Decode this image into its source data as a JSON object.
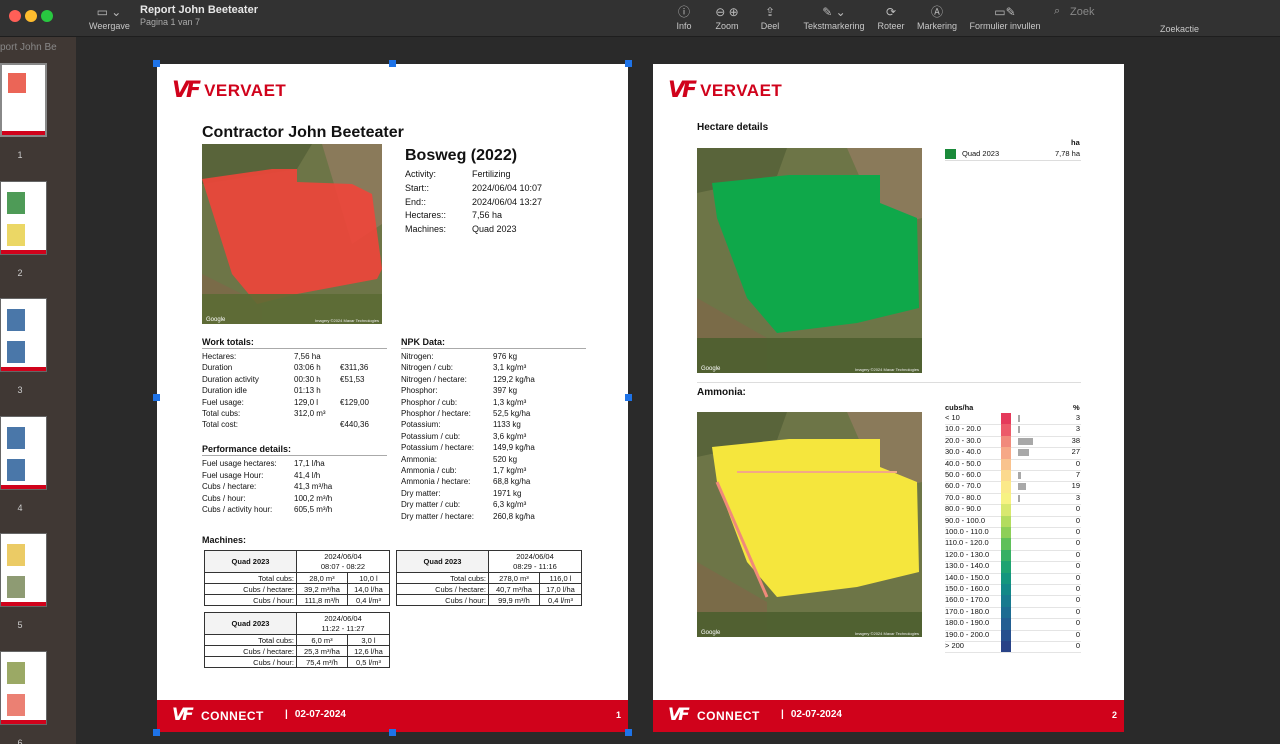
{
  "window": {
    "title": "Report John Beeteater",
    "subtitle": "Pagina 1 van 7",
    "view_label": "Weergave"
  },
  "toolbar": {
    "info": "Info",
    "zoom": "Zoom",
    "share": "Deel",
    "markup_text": "Tekstmarkering",
    "rotate": "Roteer",
    "markup": "Markering",
    "form": "Formulier invullen",
    "search_placeholder": "Zoek",
    "search_action": "Zoekactie"
  },
  "sidebar": {
    "doc_title": "port John Be",
    "thumbs": [
      "1",
      "2",
      "3",
      "4",
      "5",
      "6"
    ]
  },
  "brand": {
    "name": "VERVAET",
    "mark": "VF",
    "connect": "CONNECT",
    "date": "02-07-2024"
  },
  "page1": {
    "number": "1",
    "contractor": "Contractor John Beeteater",
    "field": "Bosweg (2022)",
    "info": [
      [
        "Activity:",
        "Fertilizing"
      ],
      [
        "Start::",
        "2024/06/04 10:07"
      ],
      [
        "End::",
        "2024/06/04 13:27"
      ],
      [
        "Hectares::",
        "7,56 ha"
      ],
      [
        "Machines:",
        "Quad 2023"
      ]
    ],
    "work_title": "Work totals:",
    "work": [
      [
        "Hectares:",
        "7,56 ha",
        ""
      ],
      [
        "Duration",
        "03:06 h",
        "€311,36"
      ],
      [
        "Duration activity",
        "00:30 h",
        "€51,53"
      ],
      [
        "Duration idle",
        "01:13 h",
        ""
      ],
      [
        "Fuel usage:",
        "129,0 l",
        "€129,00"
      ],
      [
        "Total cubs:",
        "312,0 m³",
        ""
      ],
      [
        "Total cost:",
        "",
        "€440,36"
      ]
    ],
    "perf_title": "Performance details:",
    "perf": [
      [
        "Fuel usage hectares:",
        "17,1 l/ha"
      ],
      [
        "Fuel usage Hour:",
        "41,4 l/h"
      ],
      [
        "Cubs / hectare:",
        "41,3 m³/ha"
      ],
      [
        "Cubs / hour:",
        "100,2 m³/h"
      ],
      [
        "Cubs / activity hour:",
        "605,5 m³/h"
      ]
    ],
    "npk_title": "NPK Data:",
    "npk": [
      [
        "Nitrogen:",
        "976 kg"
      ],
      [
        "Nitrogen / cub:",
        "3,1 kg/m³"
      ],
      [
        "Nitrogen / hectare:",
        "129,2 kg/ha"
      ],
      [
        "Phosphor:",
        "397 kg"
      ],
      [
        "Phosphor / cub:",
        "1,3 kg/m³"
      ],
      [
        "Phosphor / hectare:",
        "52,5 kg/ha"
      ],
      [
        "Potassium:",
        "1133 kg"
      ],
      [
        "Potassium / cub:",
        "3,6 kg/m³"
      ],
      [
        "Potassium / hectare:",
        "149,9 kg/ha"
      ],
      [
        "Ammonia:",
        "520 kg"
      ],
      [
        "Ammonia / cub:",
        "1,7 kg/m³"
      ],
      [
        "Ammonia / hectare:",
        "68,8 kg/ha"
      ],
      [
        "Dry matter:",
        "1971 kg"
      ],
      [
        "Dry matter / cub:",
        "6,3 kg/m³"
      ],
      [
        "Dry matter / hectare:",
        "260,8 kg/ha"
      ]
    ],
    "machines_title": "Machines:",
    "machines": [
      {
        "name": "Quad 2023",
        "date": "2024/06/04",
        "time": "08:07 - 08:22",
        "rows": [
          [
            "Total cubs:",
            "28,0 m³",
            "10,0 l"
          ],
          [
            "Cubs / hectare:",
            "39,2 m³/ha",
            "14,0 l/ha"
          ],
          [
            "Cubs / hour:",
            "111,8 m³/h",
            "0,4 l/m³"
          ]
        ]
      },
      {
        "name": "Quad 2023",
        "date": "2024/06/04",
        "time": "08:29 - 11:16",
        "rows": [
          [
            "Total cubs:",
            "278,0 m³",
            "116,0 l"
          ],
          [
            "Cubs / hectare:",
            "40,7 m³/ha",
            "17,0 l/ha"
          ],
          [
            "Cubs / hour:",
            "99,9 m³/h",
            "0,4 l/m³"
          ]
        ]
      },
      {
        "name": "Quad 2023",
        "date": "2024/06/04",
        "time": "11:22 - 11:27",
        "rows": [
          [
            "Total cubs:",
            "6,0 m³",
            "3,0 l"
          ],
          [
            "Cubs / hectare:",
            "25,3 m³/ha",
            "12,6 l/ha"
          ],
          [
            "Cubs / hour:",
            "75,4 m³/h",
            "0,5 l/m³"
          ]
        ]
      }
    ],
    "map_google": "Google",
    "map_copy": "Imagery ©2024 Maxar Technologies"
  },
  "page2": {
    "number": "2",
    "hectare_title": "Hectare details",
    "ha_head": "ha",
    "ha_rows": [
      {
        "label": "Quad 2023",
        "value": "7,78 ha",
        "color": "#1a8a3a"
      }
    ],
    "ammonia_title": "Ammonia:",
    "amm_head_left": "cubs/ha",
    "amm_head_right": "%",
    "amm_rows": [
      {
        "label": "< 10",
        "pct": 3,
        "color": "#e53a5b"
      },
      {
        "label": "10.0 - 20.0",
        "pct": 3,
        "color": "#ec5b6a"
      },
      {
        "label": "20.0 - 30.0",
        "pct": 38,
        "color": "#f18a7c"
      },
      {
        "label": "30.0 - 40.0",
        "pct": 27,
        "color": "#f6a887"
      },
      {
        "label": "40.0 - 50.0",
        "pct": 0,
        "color": "#f9c38e"
      },
      {
        "label": "50.0 - 60.0",
        "pct": 7,
        "color": "#fbd98e"
      },
      {
        "label": "60.0 - 70.0",
        "pct": 19,
        "color": "#fbe98a"
      },
      {
        "label": "70.0 - 80.0",
        "pct": 3,
        "color": "#f7f283"
      },
      {
        "label": "80.0 - 90.0",
        "pct": 0,
        "color": "#d8e86f"
      },
      {
        "label": "90.0 - 100.0",
        "pct": 0,
        "color": "#b3dc5f"
      },
      {
        "label": "100.0 - 110.0",
        "pct": 0,
        "color": "#8dcf58"
      },
      {
        "label": "110.0 - 120.0",
        "pct": 0,
        "color": "#5fc05a"
      },
      {
        "label": "120.0 - 130.0",
        "pct": 0,
        "color": "#36b064"
      },
      {
        "label": "130.0 - 140.0",
        "pct": 0,
        "color": "#1ea371"
      },
      {
        "label": "140.0 - 150.0",
        "pct": 0,
        "color": "#14967e"
      },
      {
        "label": "150.0 - 160.0",
        "pct": 0,
        "color": "#138888"
      },
      {
        "label": "160.0 - 170.0",
        "pct": 0,
        "color": "#187a8f"
      },
      {
        "label": "170.0 - 180.0",
        "pct": 0,
        "color": "#1d6c92"
      },
      {
        "label": "180.0 - 190.0",
        "pct": 0,
        "color": "#225e92"
      },
      {
        "label": "190.0 - 200.0",
        "pct": 0,
        "color": "#26508e"
      },
      {
        "label": "> 200",
        "pct": 0,
        "color": "#284287"
      }
    ],
    "map_google": "Google",
    "map_copy": "Imagery ©2024 Maxar Technologies"
  },
  "colors": {
    "brand_red": "#d0021b",
    "page_bg": "#ffffff",
    "fert_red": "#f0453a",
    "hectare_green": "#0fa84a",
    "ammonia_yellow": "#f5e63d",
    "selection_blue": "#1e73e8"
  }
}
